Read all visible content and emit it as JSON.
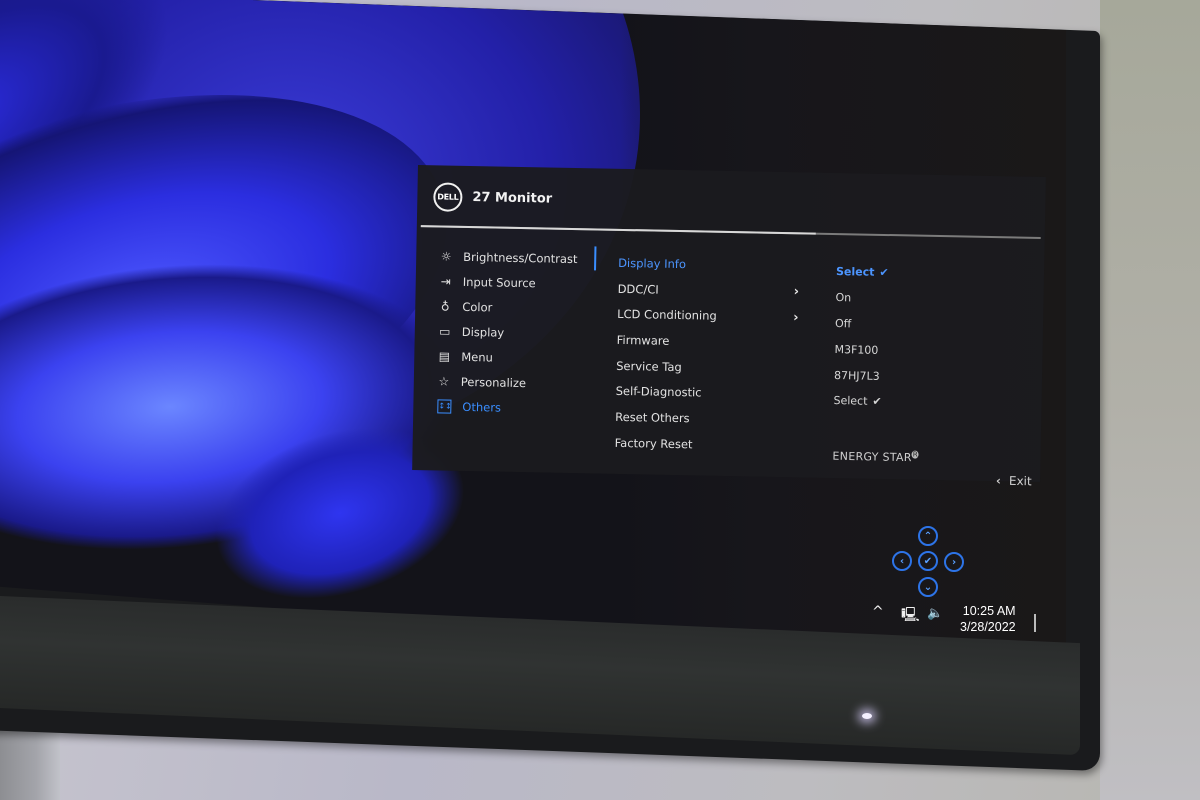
{
  "osd": {
    "brand_logo": "DELL",
    "title": "27 Monitor",
    "main_menu": [
      {
        "label": "Brightness/Contrast",
        "icon": "brightness-icon",
        "glyph": "☼",
        "active": false
      },
      {
        "label": "Input Source",
        "icon": "input-source-icon",
        "glyph": "⇥",
        "active": false
      },
      {
        "label": "Color",
        "icon": "color-palette-icon",
        "glyph": "♁",
        "active": false
      },
      {
        "label": "Display",
        "icon": "display-icon",
        "glyph": "▭",
        "active": false
      },
      {
        "label": "Menu",
        "icon": "menu-icon",
        "glyph": "▤",
        "active": false
      },
      {
        "label": "Personalize",
        "icon": "star-icon",
        "glyph": "☆",
        "active": false
      },
      {
        "label": "Others",
        "icon": "others-icon",
        "glyph": "↕↕",
        "active": true
      }
    ],
    "submenu": [
      {
        "label": "Display Info",
        "has_chevron": false,
        "active": true
      },
      {
        "label": "DDC/CI",
        "has_chevron": true,
        "active": false
      },
      {
        "label": "LCD Conditioning",
        "has_chevron": true,
        "active": false
      },
      {
        "label": "Firmware",
        "has_chevron": false,
        "active": false
      },
      {
        "label": "Service Tag",
        "has_chevron": false,
        "active": false
      },
      {
        "label": "Self-Diagnostic",
        "has_chevron": false,
        "active": false
      },
      {
        "label": "Reset Others",
        "has_chevron": false,
        "active": false
      },
      {
        "label": "Factory Reset",
        "has_chevron": false,
        "active": false
      }
    ],
    "values": [
      {
        "text": "Select",
        "check": "✔",
        "active": true
      },
      {
        "text": "On",
        "check": "",
        "active": false
      },
      {
        "text": "Off",
        "check": "",
        "active": false
      },
      {
        "text": "M3F100",
        "check": "",
        "active": false
      },
      {
        "text": "87HJ7L3",
        "check": "",
        "active": false
      },
      {
        "text": "Select",
        "check": "✔",
        "active": false
      }
    ],
    "energy_star": "ENERGY STAR",
    "energy_star_mark": "R",
    "chevron_glyph": "›",
    "exit_arrow": "‹",
    "exit_label": "Exit",
    "accent_color": "#3a8eff"
  },
  "nav_pad": {
    "up": "⌃",
    "down": "⌄",
    "left": "‹",
    "right": "›",
    "ok": "✔"
  },
  "taskbar": {
    "tray_up": "^",
    "network": "🖳",
    "volume": "🔈",
    "time": "10:25 AM",
    "date": "3/28/2022"
  }
}
